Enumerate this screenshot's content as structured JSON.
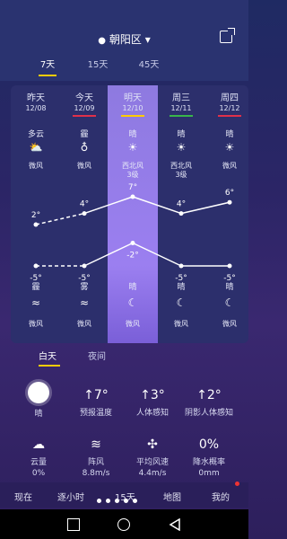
{
  "header": {
    "location": "朝阳区",
    "pin_icon": "location-pin-icon",
    "dropdown_icon": "chevron-down-icon",
    "share_icon": "share-icon"
  },
  "range_tabs": [
    {
      "label": "7天",
      "active": true
    },
    {
      "label": "15天",
      "active": false
    },
    {
      "label": "45天",
      "active": false
    }
  ],
  "days": [
    {
      "name": "昨天",
      "date": "12/08",
      "cond": "多云",
      "icon": "cloudy-sun-icon",
      "wind": "微风",
      "hi": "2°",
      "lo": "-5°",
      "night_cond": "霾",
      "night_icon": "haze-icon",
      "night_wind": "微风",
      "bar": ""
    },
    {
      "name": "今天",
      "date": "12/09",
      "cond": "霾",
      "icon": "haze-icon",
      "wind": "微风",
      "hi": "4°",
      "lo": "-5°",
      "night_cond": "雾",
      "night_icon": "fog-icon",
      "night_wind": "微风",
      "bar": "#e0304a"
    },
    {
      "name": "明天",
      "date": "12/10",
      "cond": "晴",
      "icon": "sun-icon",
      "wind": "西北风\n3级",
      "hi": "7°",
      "lo": "-2°",
      "night_cond": "晴",
      "night_icon": "moon-icon",
      "night_wind": "微风",
      "bar": "#ffcc00"
    },
    {
      "name": "周三",
      "date": "12/11",
      "cond": "晴",
      "icon": "sun-icon",
      "wind": "西北风\n3级",
      "hi": "4°",
      "lo": "-5°",
      "night_cond": "晴",
      "night_icon": "moon-icon",
      "night_wind": "微风",
      "bar": "#39b54a"
    },
    {
      "name": "周四",
      "date": "12/12",
      "cond": "晴",
      "icon": "sun-icon",
      "wind": "微风",
      "hi": "6°",
      "lo": "-5°",
      "night_cond": "晴",
      "night_icon": "moon-icon",
      "night_wind": "微风",
      "bar": "#e0304a"
    }
  ],
  "temps": {
    "hi": [
      2,
      4,
      7,
      4,
      6
    ],
    "lo": [
      -5,
      -5,
      -2,
      -5,
      -5
    ]
  },
  "detail_tabs": [
    {
      "label": "白天",
      "active": true
    },
    {
      "label": "夜间",
      "active": false
    }
  ],
  "stats_row1": [
    {
      "icon": "sun-icon",
      "value": "",
      "label": "晴"
    },
    {
      "icon": "up-arrow-icon",
      "value": "↑7°",
      "label": "预报温度"
    },
    {
      "icon": "up-arrow-icon",
      "value": "↑3°",
      "label": "人体感知"
    },
    {
      "icon": "up-arrow-icon",
      "value": "↑2°",
      "label": "阴影人体感知"
    }
  ],
  "stats_row2": [
    {
      "icon": "cloud-icon",
      "label": "云量",
      "value": "0%"
    },
    {
      "icon": "wind-icon",
      "label": "阵风",
      "value": "8.8m/s"
    },
    {
      "icon": "fan-icon",
      "label": "平均风速",
      "value": "4.4m/s"
    },
    {
      "icon": "percent-icon",
      "label": "降水概率",
      "value": "0mm"
    }
  ],
  "nav": [
    {
      "label": "现在"
    },
    {
      "label": "逐小时"
    },
    {
      "label": "15天"
    },
    {
      "label": "地图"
    },
    {
      "label": "我的"
    }
  ]
}
